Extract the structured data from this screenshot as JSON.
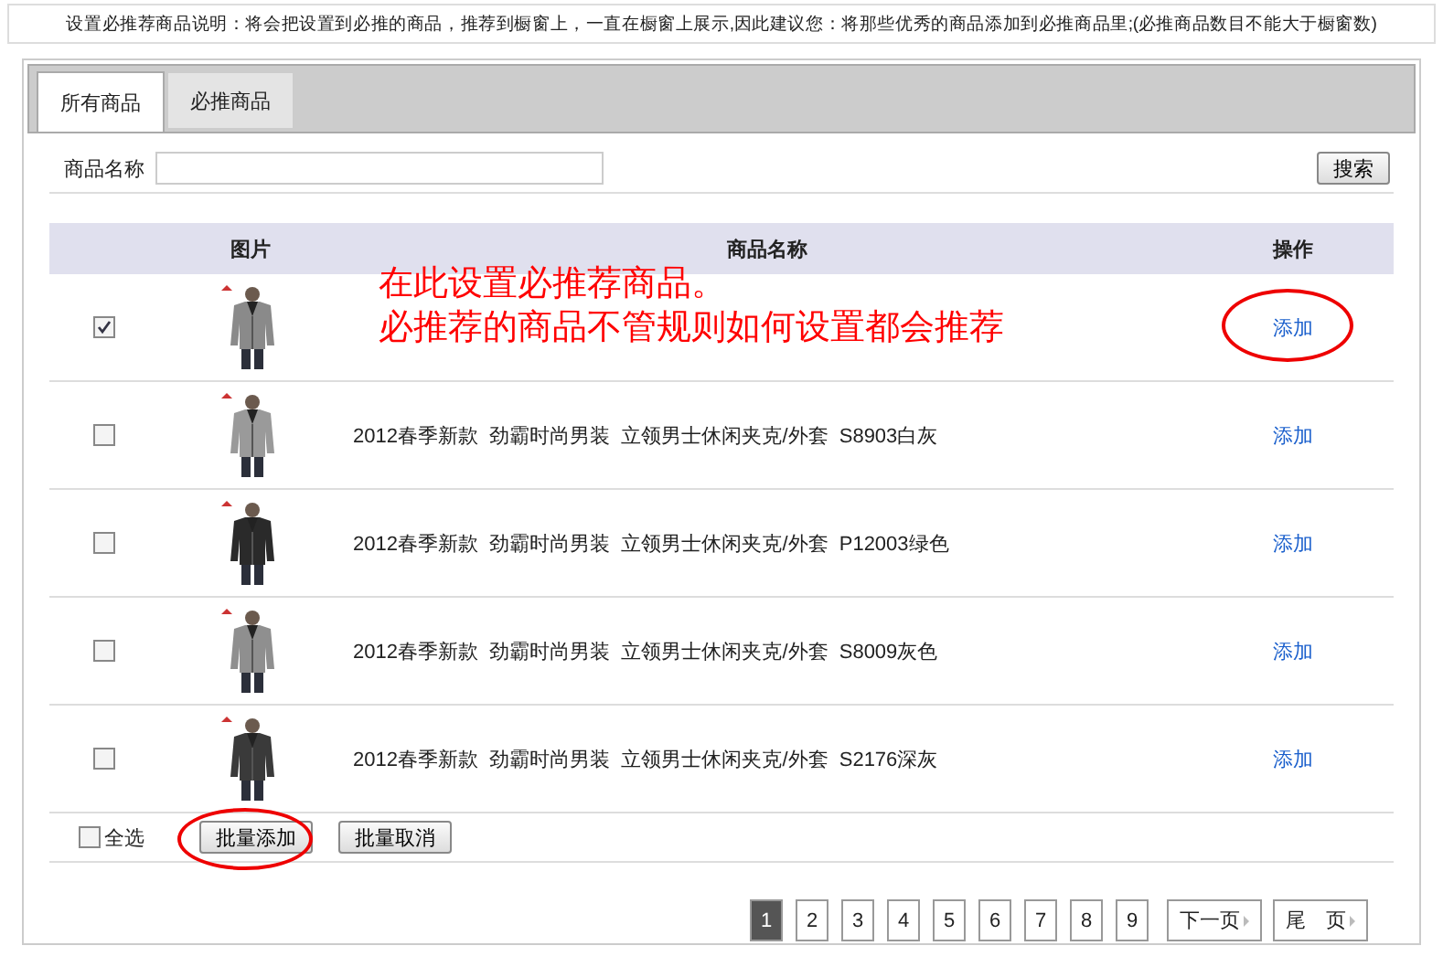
{
  "notice": "设置必推荐商品说明：将会把设置到必推的商品，推荐到橱窗上，一直在橱窗上展示,因此建议您：将那些优秀的商品添加到必推商品里;(必推商品数目不能大于橱窗数)",
  "tabs": [
    {
      "label": "所有商品",
      "selected": true
    },
    {
      "label": "必推商品",
      "selected": false
    }
  ],
  "search": {
    "label": "商品名称",
    "button": "搜索"
  },
  "table": {
    "columns": [
      "图片",
      "商品名称",
      "操作"
    ],
    "rows": [
      {
        "checked": true,
        "action": "添加",
        "highlighted": true
      },
      {
        "checked": false,
        "name": "2012春季新款  劲霸时尚男装  立领男士休闲夹克/外套  S8903白灰",
        "action": "添加",
        "highlighted": false
      },
      {
        "checked": false,
        "name": "2012春季新款  劲霸时尚男装  立领男士休闲夹克/外套  P12003绿色",
        "action": "添加",
        "highlighted": false
      },
      {
        "checked": false,
        "name": "2012春季新款  劲霸时尚男装  立领男士休闲夹克/外套  S8009灰色",
        "action": "添加",
        "highlighted": false
      },
      {
        "checked": false,
        "name": "2012春季新款  劲霸时尚男装  立领男士休闲夹克/外套  S2176深灰",
        "action": "添加",
        "highlighted": false
      }
    ]
  },
  "annotation": [
    "在此设置必推荐商品。",
    "必推荐的商品不管规则如何设置都会推荐"
  ],
  "footer": {
    "select_all": {
      "label": "全选",
      "checked": false
    },
    "buttons": [
      {
        "label": "批量添加",
        "highlighted": true
      },
      {
        "label": "批量取消",
        "highlighted": false
      }
    ]
  },
  "pagination": {
    "pages": [
      {
        "label": "1",
        "selected": true
      },
      {
        "label": "2",
        "selected": false
      },
      {
        "label": "3",
        "selected": false
      },
      {
        "label": "4",
        "selected": false
      },
      {
        "label": "5",
        "selected": false
      },
      {
        "label": "6",
        "selected": false
      },
      {
        "label": "7",
        "selected": false
      },
      {
        "label": "8",
        "selected": false
      },
      {
        "label": "9",
        "selected": false
      }
    ],
    "next": "下一页",
    "last": "尾　页"
  }
}
